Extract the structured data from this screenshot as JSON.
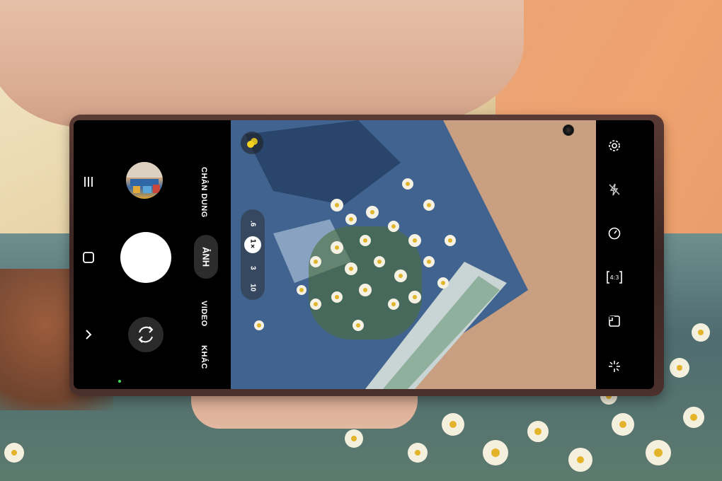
{
  "camera": {
    "modes": {
      "portrait": "CHÂN DUNG",
      "photo": "ẢNH",
      "video": "VIDEO",
      "more": "KHÁC"
    },
    "zoom": {
      "wide": ".6",
      "active": "1×",
      "tele3": "3",
      "tele10": "10"
    },
    "right_toolbar_icons": [
      "settings-icon",
      "flash-off-icon",
      "timer-icon",
      "aspect-ratio-icon",
      "motion-photo-icon",
      "effects-icon"
    ],
    "left_toolbar_icons": [
      "menu-icon",
      "recents-icon",
      "back-icon"
    ],
    "aspect_ratio": "4:3"
  },
  "colors": {
    "accent_green": "#3ddc5a",
    "accent_orange": "#ff7a1a",
    "filter_yellow": "#f4d21d"
  }
}
